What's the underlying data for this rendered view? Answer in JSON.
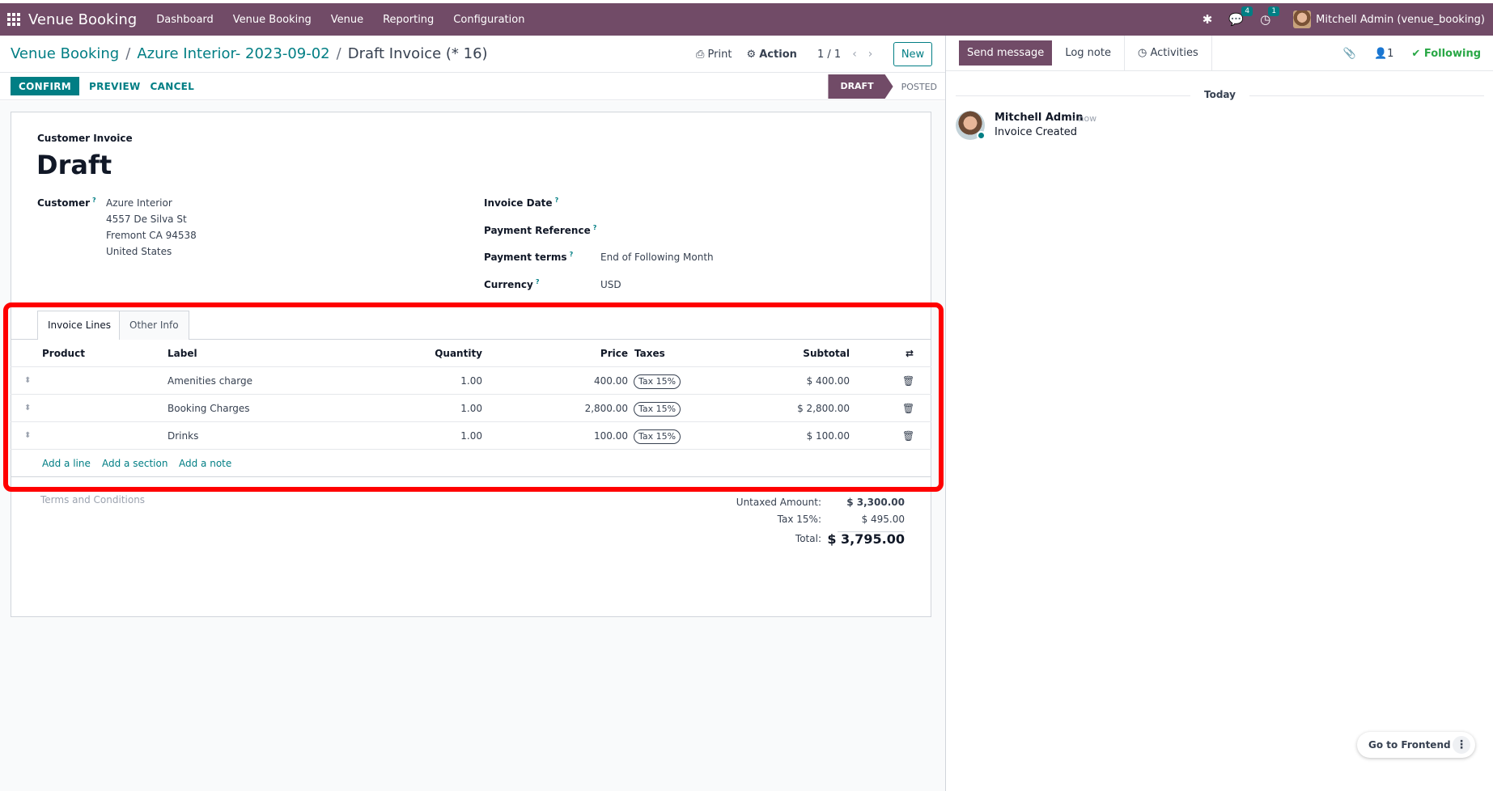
{
  "nav": {
    "app_title": "Venue Booking",
    "menu": [
      "Dashboard",
      "Venue Booking",
      "Venue",
      "Reporting",
      "Configuration"
    ],
    "messages_count": "4",
    "activities_count": "1",
    "user": "Mitchell Admin (venue_booking)"
  },
  "breadcrumb": {
    "root": "Venue Booking",
    "record": "Azure Interior- 2023-09-02",
    "current": "Draft Invoice (* 16)"
  },
  "control": {
    "print": "Print",
    "action": "Action",
    "pager": "1 / 1",
    "new": "New"
  },
  "status": {
    "confirm": "CONFIRM",
    "preview": "PREVIEW",
    "cancel": "CANCEL",
    "stages": [
      "DRAFT",
      "POSTED"
    ],
    "active_stage": "DRAFT"
  },
  "form": {
    "type_label": "Customer Invoice",
    "title": "Draft",
    "customer_label": "Customer",
    "customer_lines": [
      "Azure Interior",
      "4557 De Silva St",
      "Fremont CA 94538",
      "United States"
    ],
    "invoice_date_label": "Invoice Date",
    "payment_reference_label": "Payment Reference",
    "payment_terms_label": "Payment terms",
    "payment_terms_value": "End of Following Month",
    "currency_label": "Currency",
    "currency_value": "USD",
    "help_mark": "?"
  },
  "tabs": [
    "Invoice Lines",
    "Other Info"
  ],
  "table": {
    "headers": [
      "Product",
      "Label",
      "Quantity",
      "Price",
      "Taxes",
      "Subtotal"
    ],
    "rows": [
      {
        "label": "Amenities charge",
        "quantity": "1.00",
        "price": "400.00",
        "tax": "Tax 15%",
        "subtotal": "$ 400.00"
      },
      {
        "label": "Booking Charges",
        "quantity": "1.00",
        "price": "2,800.00",
        "tax": "Tax 15%",
        "subtotal": "$ 2,800.00"
      },
      {
        "label": "Drinks",
        "quantity": "1.00",
        "price": "100.00",
        "tax": "Tax 15%",
        "subtotal": "$ 100.00"
      }
    ],
    "add_links": [
      "Add a line",
      "Add a section",
      "Add a note"
    ]
  },
  "totals": {
    "terms_placeholder": "Terms and Conditions",
    "untaxed_label": "Untaxed Amount:",
    "untaxed_value": "$ 3,300.00",
    "tax_label": "Tax 15%:",
    "tax_value": "$ 495.00",
    "total_label": "Total:",
    "total_value": "$ 3,795.00"
  },
  "chatter": {
    "send_message": "Send message",
    "log_note": "Log note",
    "activities": "Activities",
    "followers_count": "1",
    "following": "Following",
    "today": "Today",
    "author": "Mitchell Admin",
    "time": "- now",
    "body": "Invoice Created"
  },
  "frontend": {
    "label": "Go to Frontend"
  },
  "colors": {
    "brand": "#714b67",
    "accent": "#017e84",
    "highlight": "#ff0000",
    "following": "#28a745"
  }
}
